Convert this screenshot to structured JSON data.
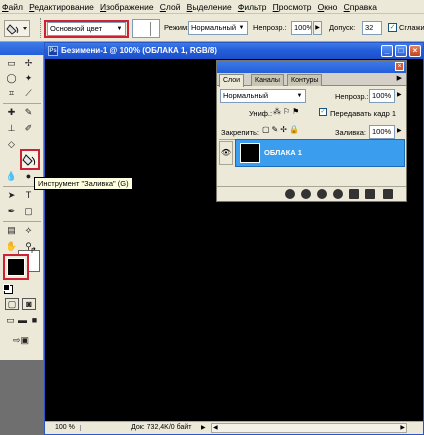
{
  "menu": [
    "Файл",
    "Редактирование",
    "Изображение",
    "Слой",
    "Выделение",
    "Фильтр",
    "Просмотр",
    "Окно",
    "Справка"
  ],
  "options": {
    "fill_source": "Основной цвет",
    "mode_label": "Режим:",
    "mode_value": "Нормальный",
    "opacity_label": "Непрозр.:",
    "opacity_value": "100%",
    "tolerance_label": "Допуск:",
    "tolerance_value": "32",
    "smoothing_label": "Сглажи"
  },
  "document": {
    "title": "Безимени-1 @ 100% (ОБЛАКА 1, RGB/8)",
    "zoom": "100 %",
    "doc_info": "Док: 732,4K/0 байт"
  },
  "layers_panel": {
    "tabs": [
      "Слои",
      "Каналы",
      "Контуры"
    ],
    "blend_mode": "Нормальный",
    "opacity_label": "Непрозр.:",
    "opacity_value": "100%",
    "unify_label": "Униф.:",
    "propagate_label": "Передавать кадр 1",
    "lock_label": "Закрепить:",
    "fill_label": "Заливка:",
    "fill_value": "100%",
    "layer_name": "ОБЛАКА 1"
  },
  "tooltip": "Инструмент \"Заливка\" (G)",
  "colors": {
    "foreground": "#000000",
    "background": "#ffffff",
    "highlight": "#cc2233",
    "layer_selected": "#3a9ded",
    "title_bar": "#245edb"
  }
}
